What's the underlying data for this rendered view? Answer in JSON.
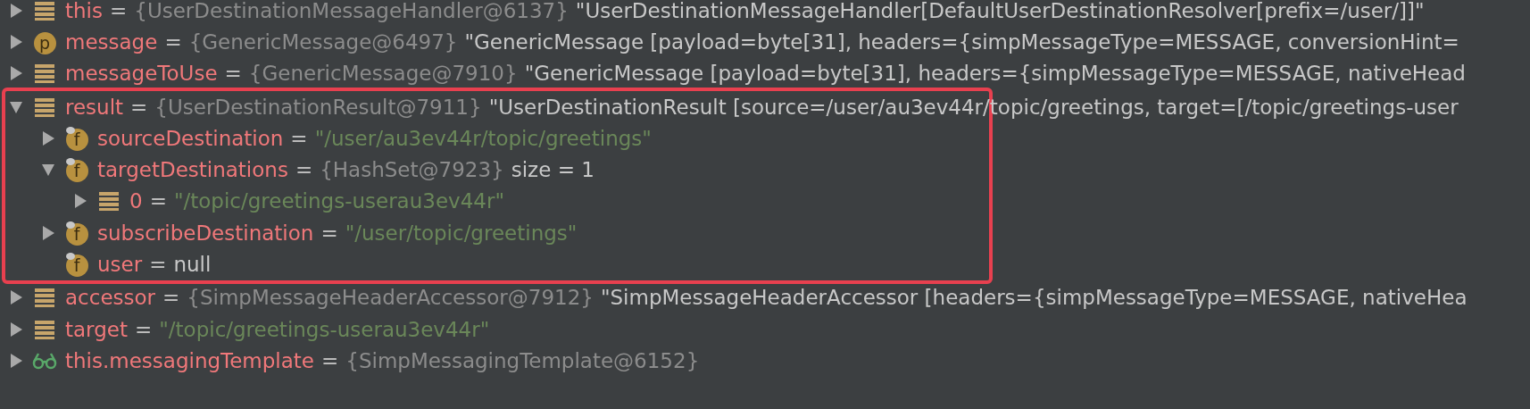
{
  "variables": [
    {
      "kind": "local",
      "name": "this",
      "equals": "=",
      "expanded": false,
      "highlighted": false,
      "value": [
        {
          "kind": "ref",
          "text": "{UserDestinationMessageHandler@6137}"
        },
        {
          "kind": "text",
          "text": "\"UserDestinationMessageHandler[DefaultUserDestinationResolver[prefix=/user/]]\""
        }
      ]
    },
    {
      "kind": "parameter",
      "badge_letter": "p",
      "name": "message",
      "equals": "=",
      "expanded": false,
      "highlighted": false,
      "value": [
        {
          "kind": "ref",
          "text": "{GenericMessage@6497}"
        },
        {
          "kind": "text",
          "text": "\"GenericMessage [payload=byte[31], headers={simpMessageType=MESSAGE, conversionHint="
        }
      ]
    },
    {
      "kind": "local",
      "name": "messageToUse",
      "equals": "=",
      "expanded": false,
      "highlighted": false,
      "value": [
        {
          "kind": "ref",
          "text": "{GenericMessage@7910}"
        },
        {
          "kind": "text",
          "text": "\"GenericMessage [payload=byte[31], headers={simpMessageType=MESSAGE, nativeHead"
        }
      ]
    },
    {
      "kind": "local",
      "name": "result",
      "equals": "=",
      "expanded": true,
      "highlighted": true,
      "value": [
        {
          "kind": "ref",
          "text": "{UserDestinationResult@7911}"
        },
        {
          "kind": "text",
          "text": "\"UserDestinationResult [source=/user/au3ev44r/topic/greetings, target=[/topic/greetings-user"
        }
      ],
      "children": [
        {
          "kind": "field",
          "badge_letter": "f",
          "name": "sourceDestination",
          "equals": "=",
          "expanded": false,
          "value": [
            {
              "kind": "string",
              "text": "\"/user/au3ev44r/topic/greetings\""
            }
          ]
        },
        {
          "kind": "field",
          "badge_letter": "f",
          "name": "targetDestinations",
          "equals": "=",
          "expanded": true,
          "value": [
            {
              "kind": "ref",
              "text": "{HashSet@7923}"
            },
            {
              "kind": "text",
              "text": "size = 1"
            }
          ],
          "children": [
            {
              "kind": "local",
              "name": "0",
              "equals": "=",
              "expanded": false,
              "value": [
                {
                  "kind": "string",
                  "text": "\"/topic/greetings-userau3ev44r\""
                }
              ]
            }
          ]
        },
        {
          "kind": "field",
          "badge_letter": "f",
          "name": "subscribeDestination",
          "equals": "=",
          "expanded": false,
          "value": [
            {
              "kind": "string",
              "text": "\"/user/topic/greetings\""
            }
          ]
        },
        {
          "kind": "field",
          "badge_letter": "f",
          "name": "user",
          "equals": "=",
          "value": [
            {
              "kind": "text",
              "text": "null"
            }
          ]
        }
      ]
    },
    {
      "kind": "local",
      "name": "accessor",
      "equals": "=",
      "expanded": false,
      "highlighted": false,
      "value": [
        {
          "kind": "ref",
          "text": "{SimpMessageHeaderAccessor@7912}"
        },
        {
          "kind": "text",
          "text": "\"SimpMessageHeaderAccessor [headers={simpMessageType=MESSAGE, nativeHea"
        }
      ]
    },
    {
      "kind": "local",
      "name": "target",
      "equals": "=",
      "expanded": false,
      "highlighted": false,
      "value": [
        {
          "kind": "string",
          "text": "\"/topic/greetings-userau3ev44r\""
        }
      ]
    },
    {
      "kind": "watch",
      "name": "this.messagingTemplate",
      "equals": "=",
      "expanded": false,
      "highlighted": false,
      "value": [
        {
          "kind": "ref",
          "text": "{SimpMessagingTemplate@6152}"
        }
      ]
    }
  ]
}
